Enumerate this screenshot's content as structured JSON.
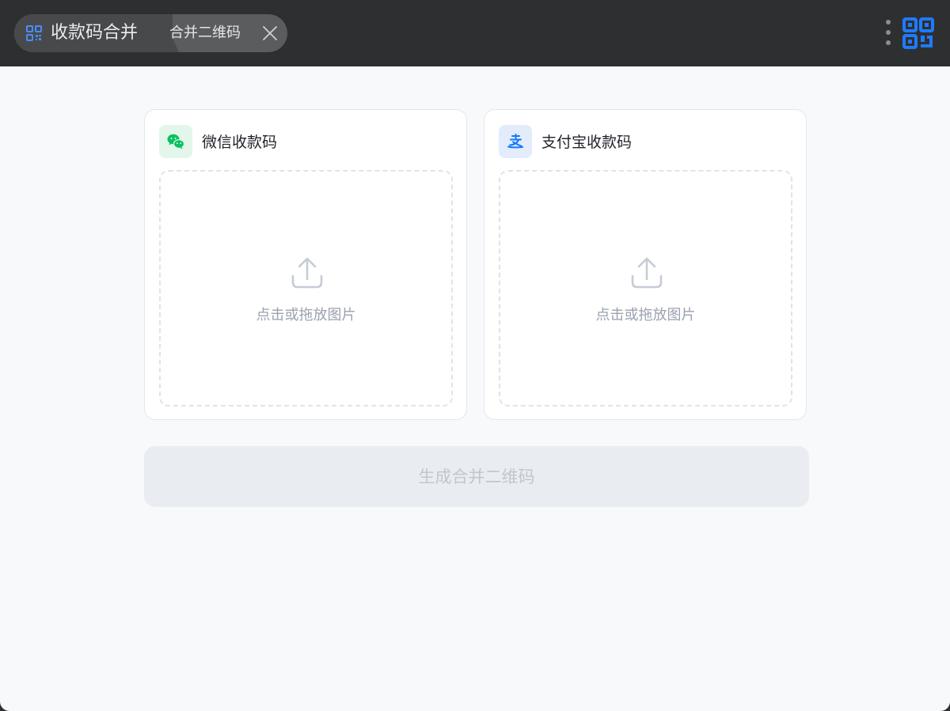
{
  "titlebar": {
    "app_name": "收款码合并",
    "current_page": "合并二维码",
    "icons": {
      "app": "qr-code-icon",
      "close": "close-icon",
      "more": "more-vertical-icon",
      "logo": "qr-code-logo-icon"
    }
  },
  "cards": [
    {
      "id": "wechat",
      "title": "微信收款码",
      "icon": "wechat-icon",
      "icon_color": "#07c160",
      "dropzone_hint": "点击或拖放图片"
    },
    {
      "id": "alipay",
      "title": "支付宝收款码",
      "icon": "alipay-icon",
      "icon_color": "#1677ff",
      "dropzone_hint": "点击或拖放图片"
    }
  ],
  "actions": {
    "generate_label": "生成合并二维码",
    "generate_enabled": false
  },
  "colors": {
    "accent": "#1677ff",
    "wechat": "#07c160",
    "titlebar_bg": "#2e2f31",
    "content_bg": "#f8f9fb"
  }
}
